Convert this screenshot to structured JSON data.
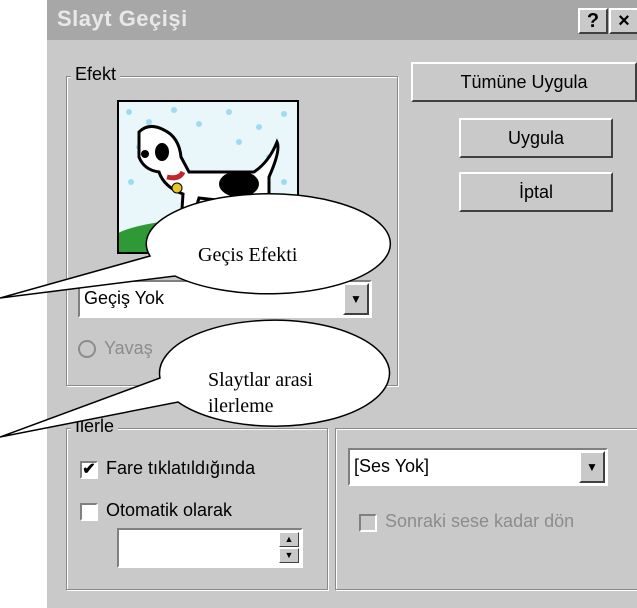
{
  "dialog": {
    "title": "Slayt Geçişi",
    "help_button": "?",
    "close_button": "×"
  },
  "effect_group": {
    "legend": "Efekt",
    "transition_select": {
      "value": "Geçiş Yok"
    },
    "speed_radio_label": "Yavaş"
  },
  "buttons": {
    "apply_all": "Tümüne Uygula",
    "apply": "Uygula",
    "cancel": "İptal"
  },
  "advance_group": {
    "legend": "İlerle",
    "on_click": {
      "label": "Fare tıklatıldığında",
      "checked": true
    },
    "automatic": {
      "label": "Otomatik olarak",
      "checked": false
    },
    "seconds_value": ""
  },
  "sound_group": {
    "sound_select": {
      "value": "[Ses Yok]"
    },
    "loop_label": "Sonraki sese kadar dön"
  },
  "callouts": {
    "transition_effect": "Geçis Efekti",
    "advance_line1": "Slaytlar arasi",
    "advance_line2": "ilerleme"
  },
  "icons": {
    "dropdown": "chevron-down-icon",
    "spin_up": "arrow-up-icon",
    "spin_down": "arrow-down-icon",
    "check": "check-icon"
  },
  "colors": {
    "dialog_face": "#c9c9c9",
    "title_bar": "#a7a7a7",
    "callout_fill": "#ffffff"
  }
}
